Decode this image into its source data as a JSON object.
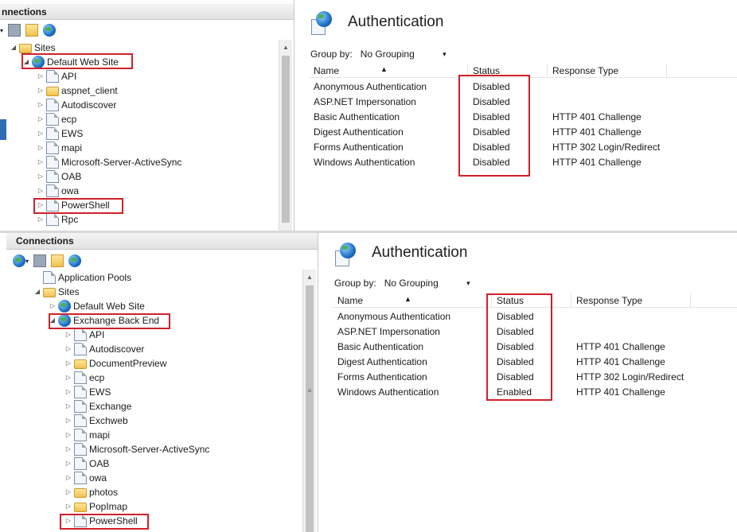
{
  "top": {
    "connections_title": "nnections",
    "tree": [
      {
        "label": "Sites",
        "icon": "sites-icon",
        "expand": "◢"
      },
      {
        "label": "Default Web Site",
        "icon": "globe-icon",
        "expand": "◢"
      },
      {
        "label": "API",
        "icon": "app-icon",
        "expand": "▷"
      },
      {
        "label": "aspnet_client",
        "icon": "folder-icon",
        "expand": "▷"
      },
      {
        "label": "Autodiscover",
        "icon": "app-icon",
        "expand": "▷"
      },
      {
        "label": "ecp",
        "icon": "app-icon",
        "expand": "▷"
      },
      {
        "label": "EWS",
        "icon": "app-icon",
        "expand": "▷"
      },
      {
        "label": "mapi",
        "icon": "app-icon",
        "expand": "▷"
      },
      {
        "label": "Microsoft-Server-ActiveSync",
        "icon": "app-icon",
        "expand": "▷"
      },
      {
        "label": "OAB",
        "icon": "app-icon",
        "expand": "▷"
      },
      {
        "label": "owa",
        "icon": "app-icon",
        "expand": "▷"
      },
      {
        "label": "PowerShell",
        "icon": "app-icon",
        "expand": "▷"
      },
      {
        "label": "Rpc",
        "icon": "app-icon",
        "expand": "▷"
      }
    ],
    "auth": {
      "title": "Authentication",
      "group_by_label": "Group by:",
      "group_by_value": "No Grouping",
      "columns": [
        "Name",
        "Status",
        "Response Type"
      ],
      "rows": [
        {
          "name": "Anonymous Authentication",
          "status": "Disabled",
          "response": ""
        },
        {
          "name": "ASP.NET Impersonation",
          "status": "Disabled",
          "response": ""
        },
        {
          "name": "Basic Authentication",
          "status": "Disabled",
          "response": "HTTP 401 Challenge"
        },
        {
          "name": "Digest Authentication",
          "status": "Disabled",
          "response": "HTTP 401 Challenge"
        },
        {
          "name": "Forms Authentication",
          "status": "Disabled",
          "response": "HTTP 302 Login/Redirect"
        },
        {
          "name": "Windows Authentication",
          "status": "Disabled",
          "response": "HTTP 401 Challenge"
        }
      ]
    }
  },
  "bottom": {
    "connections_title": "Connections",
    "tree": [
      {
        "label": "Application Pools",
        "icon": "app-pools-icon",
        "expand": ""
      },
      {
        "label": "Sites",
        "icon": "sites-icon",
        "expand": "◢"
      },
      {
        "label": "Default Web Site",
        "icon": "globe-icon",
        "expand": "▷"
      },
      {
        "label": "Exchange Back End",
        "icon": "globe-icon",
        "expand": "◢"
      },
      {
        "label": "API",
        "icon": "app-icon",
        "expand": "▷"
      },
      {
        "label": "Autodiscover",
        "icon": "app-icon",
        "expand": "▷"
      },
      {
        "label": "DocumentPreview",
        "icon": "folder-icon",
        "expand": "▷"
      },
      {
        "label": "ecp",
        "icon": "app-icon",
        "expand": "▷"
      },
      {
        "label": "EWS",
        "icon": "app-icon",
        "expand": "▷"
      },
      {
        "label": "Exchange",
        "icon": "vdir-icon",
        "expand": "▷"
      },
      {
        "label": "Exchweb",
        "icon": "vdir-icon",
        "expand": "▷"
      },
      {
        "label": "mapi",
        "icon": "app-icon",
        "expand": "▷"
      },
      {
        "label": "Microsoft-Server-ActiveSync",
        "icon": "app-icon",
        "expand": "▷"
      },
      {
        "label": "OAB",
        "icon": "app-icon",
        "expand": "▷"
      },
      {
        "label": "owa",
        "icon": "app-icon",
        "expand": "▷"
      },
      {
        "label": "photos",
        "icon": "folder-icon",
        "expand": "▷"
      },
      {
        "label": "PopImap",
        "icon": "folder-icon",
        "expand": "▷"
      },
      {
        "label": "PowerShell",
        "icon": "app-icon",
        "expand": "▷"
      }
    ],
    "auth": {
      "title": "Authentication",
      "group_by_label": "Group by:",
      "group_by_value": "No Grouping",
      "columns": [
        "Name",
        "Status",
        "Response Type"
      ],
      "rows": [
        {
          "name": "Anonymous Authentication",
          "status": "Disabled",
          "response": ""
        },
        {
          "name": "ASP.NET Impersonation",
          "status": "Disabled",
          "response": ""
        },
        {
          "name": "Basic Authentication",
          "status": "Disabled",
          "response": "HTTP 401 Challenge"
        },
        {
          "name": "Digest Authentication",
          "status": "Disabled",
          "response": "HTTP 401 Challenge"
        },
        {
          "name": "Forms Authentication",
          "status": "Disabled",
          "response": "HTTP 302 Login/Redirect"
        },
        {
          "name": "Windows Authentication",
          "status": "Enabled",
          "response": "HTTP 401 Challenge"
        }
      ]
    }
  },
  "colors": {
    "highlight_box": "#d0202a",
    "header_bg": "#e8e8e8"
  }
}
